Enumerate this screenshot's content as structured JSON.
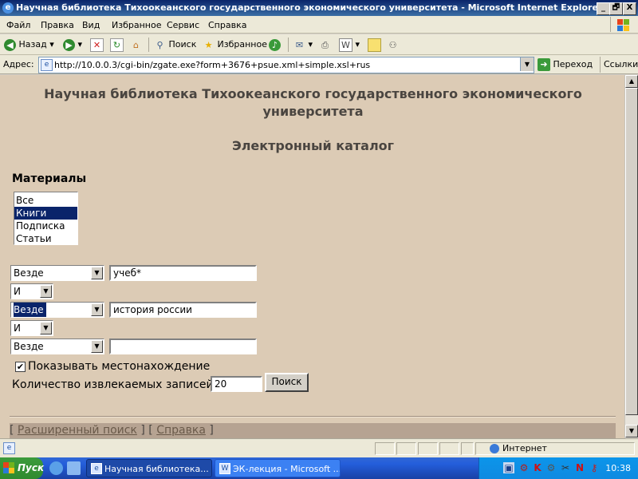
{
  "window": {
    "title": "Научная библиотека Тихоокеанского государственного экономического университета - Microsoft Internet Explorer",
    "buttons": [
      "_",
      "🗗",
      "X"
    ]
  },
  "menu": [
    "Файл",
    "Правка",
    "Вид",
    "Избранное",
    "Сервис",
    "Справка"
  ],
  "toolbar": {
    "back": "Назад",
    "search": "Поиск",
    "favorites": "Избранное"
  },
  "address": {
    "label": "Адрес:",
    "url": "http://10.0.0.3/cgi-bin/zgate.exe?form+3676+psue.xml+simple.xsl+rus",
    "go": "Переход",
    "links": "Ссылки"
  },
  "page": {
    "title": "Научная библиотека Тихоокеанского государственного экономического университета",
    "subtitle": "Электронный каталог",
    "materials_heading": "Материалы",
    "materials": [
      {
        "label": "Все",
        "selected": false
      },
      {
        "label": "Книги",
        "selected": true
      },
      {
        "label": "Подписка",
        "selected": false
      },
      {
        "label": "Статьи",
        "selected": false
      }
    ],
    "rows": [
      {
        "field": "Везде",
        "value": "учеб*"
      },
      {
        "field": "Везде",
        "value": "история россии"
      },
      {
        "field": "Везде",
        "value": ""
      }
    ],
    "operators": [
      "И",
      "И"
    ],
    "show_location": {
      "label": "Показывать местонахождение",
      "checked": true,
      "mark": "✔"
    },
    "count": {
      "label": "Количество извлекаемых записей",
      "value": "20"
    },
    "search_button": "Поиск",
    "footer": {
      "open1": "[",
      "advanced": "Расширенный поиск",
      "mid": "] [",
      "help": "Справка",
      "close": "]"
    }
  },
  "statusbar": {
    "zone": "Интернет"
  },
  "taskbar": {
    "start": "Пуск",
    "tasks": [
      "Научная библиотека...",
      "ЭК-лекция - Microsoft ..."
    ],
    "clock": "10:38"
  }
}
